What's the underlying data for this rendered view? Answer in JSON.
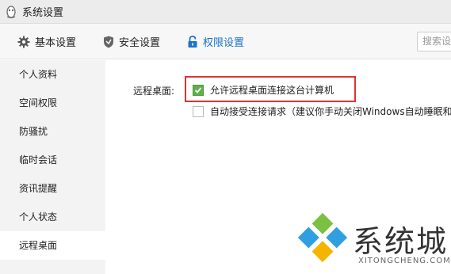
{
  "window": {
    "title": "系统设置"
  },
  "tabs": [
    {
      "label": "基本设置",
      "icon": "gear-icon"
    },
    {
      "label": "安全设置",
      "icon": "shield-icon"
    },
    {
      "label": "权限设置",
      "icon": "lock-icon",
      "active": true
    }
  ],
  "search": {
    "placeholder": "搜索设"
  },
  "sidebar": {
    "items": [
      {
        "label": "个人资料"
      },
      {
        "label": "空间权限"
      },
      {
        "label": "防骚扰"
      },
      {
        "label": "临时会话"
      },
      {
        "label": "资讯提醒"
      },
      {
        "label": "个人状态"
      },
      {
        "label": "远程桌面",
        "active": true
      }
    ]
  },
  "remote_desktop": {
    "label": "远程桌面:",
    "allow_option": {
      "text": "允许远程桌面连接这台计算机",
      "checked": true
    },
    "auto_accept_option": {
      "text": "自动接受连接请求（建议你手动关闭Windows自动睡眠和",
      "checked": false
    }
  },
  "watermark": {
    "text": "系统城",
    "url": "XITONGCHENG.COM"
  },
  "colors": {
    "accent": "#1a73c8",
    "check_green": "#5fb04a",
    "highlight_red": "#e03232"
  }
}
